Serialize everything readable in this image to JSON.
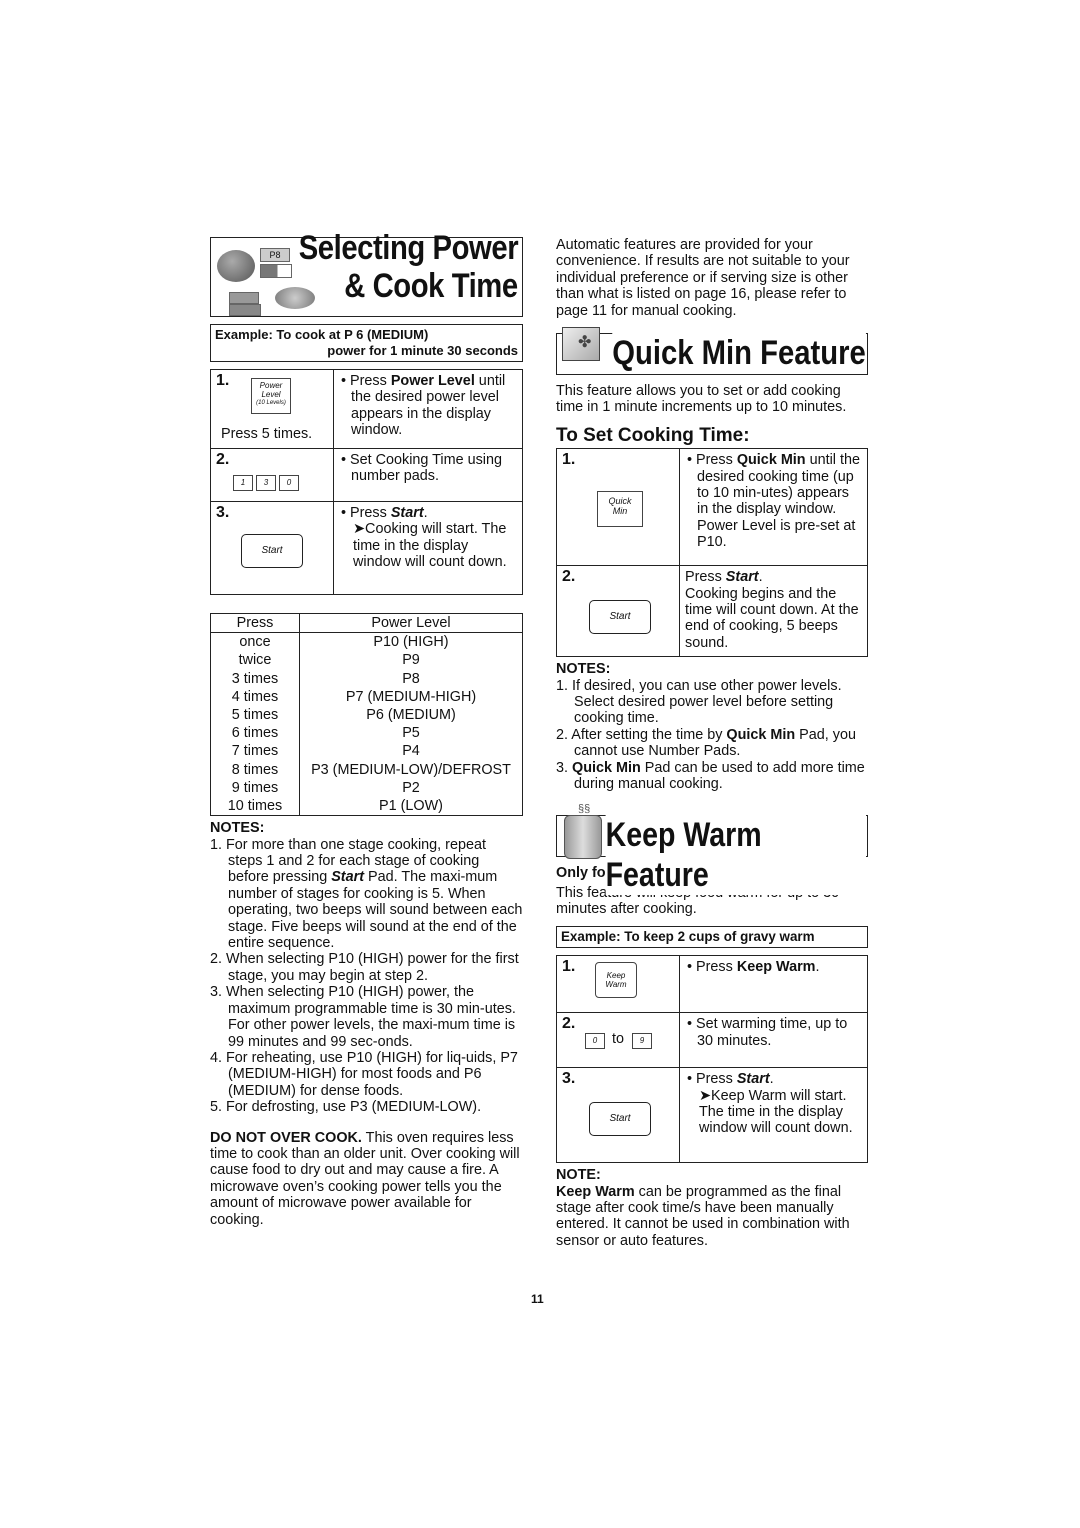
{
  "page_number": "11",
  "left": {
    "title_line1": "Selecting Power",
    "title_line2": "& Cook Time",
    "title_icons": {
      "display_text": "P8"
    },
    "example": {
      "line1": "Example: To cook at P 6 (MEDIUM)",
      "line2": "power for 1 minute 30 seconds"
    },
    "steps": [
      {
        "num": "1.",
        "pad_lines": [
          "Power",
          "Level",
          "(10 Levels)"
        ],
        "caption": "Press 5 times.",
        "text_pre": "• Press ",
        "text_bold": "Power Level",
        "text_post": " until the desired power level appears in the display window."
      },
      {
        "num": "2.",
        "number_pads": [
          "1",
          "3",
          "0"
        ],
        "text": "• Set Cooking Time using number pads."
      },
      {
        "num": "3.",
        "pad": "Start",
        "text_pre": "• Press ",
        "text_bi": "Start",
        "text_post": ".",
        "arrow_text": "➤Cooking will start. The time in the display window will count down."
      }
    ],
    "power_table": {
      "headers": [
        "Press",
        "Power Level"
      ],
      "rows": [
        [
          "once",
          "P10 (HIGH)"
        ],
        [
          "twice",
          "P9"
        ],
        [
          "3 times",
          "P8"
        ],
        [
          "4 times",
          "P7 (MEDIUM-HIGH)"
        ],
        [
          "5 times",
          "P6 (MEDIUM)"
        ],
        [
          "6 times",
          "P5"
        ],
        [
          "7 times",
          "P4"
        ],
        [
          "8 times",
          "P3 (MEDIUM-LOW)/DEFROST"
        ],
        [
          "9 times",
          "P2"
        ],
        [
          "10 times",
          "P1 (LOW)"
        ]
      ]
    },
    "notes_heading": "NOTES:",
    "notes": [
      {
        "num": "1. ",
        "pre": "For more than one stage cooking, repeat steps 1 and 2 for each stage of cooking before pressing ",
        "bi": "Start",
        "post": " Pad. The maxi-mum number of stages for cooking is 5. When operating, two beeps will sound between each stage. Five beeps will sound at the end of the entire sequence."
      },
      {
        "num": "2. ",
        "pre": "When selecting P10 (HIGH) power for the first stage, you may begin at step 2."
      },
      {
        "num": "3. ",
        "pre": "When selecting P10 (HIGH) power, the maximum programmable time is 30 min-utes. For other power levels, the maxi-mum time is 99 minutes and 99 sec-onds."
      },
      {
        "num": "4. ",
        "pre": "For reheating, use P10 (HIGH) for liq-uids, P7 (MEDIUM-HIGH) for most foods and P6 (MEDIUM) for dense foods."
      },
      {
        "num": "5. ",
        "pre": "For defrosting, use P3 (MEDIUM-LOW)."
      }
    ],
    "warning_bold": "DO NOT OVER COOK.",
    "warning_text": " This oven requires less time to cook than an older unit. Over cooking will cause food to dry out and may cause a fire. A microwave oven’s cooking power tells you the amount of microwave power available for cooking."
  },
  "right": {
    "intro": "Automatic features are provided for your convenience. If results are not suitable to your individual preference or if serving size is other than what is listed on page 16, please refer to page 11 for manual cooking.",
    "quick_min": {
      "title": "Quick Min Feature",
      "description": "This feature allows you to set or add cooking time in 1 minute increments up to 10 minutes.",
      "subheading": "To Set Cooking Time:",
      "steps": [
        {
          "num": "1.",
          "pad_lines": [
            "Quick",
            "Min"
          ],
          "text_pre": "• Press ",
          "text_bold": "Quick Min",
          "text_post": " until the desired cooking time (up to 10 min-utes) appears in the display window. Power Level is pre-set at P10."
        },
        {
          "num": "2.",
          "pad": "Start",
          "text_pre": "Press ",
          "text_bi": "Start",
          "text_post": ".",
          "text_rest": "Cooking begins and the time will count down. At the end of cooking, 5 beeps sound."
        }
      ],
      "notes_heading": "NOTES:",
      "notes": [
        {
          "num": "1. ",
          "pre": "If desired, you can use other power levels. Select desired power level before setting cooking time."
        },
        {
          "num": "2. ",
          "pre": "After setting the time by ",
          "bold": "Quick Min",
          "post": " Pad, you cannot use Number Pads."
        },
        {
          "num": "3. ",
          "bold_first": "Quick Min",
          "post": " Pad can be used to add more time during manual cooking."
        }
      ]
    },
    "keep_warm": {
      "title": "Keep Warm Feature",
      "model_note": "Only for NN-H634:",
      "description": "This feature will keep food warm for up to 30 minutes after cooking.",
      "example": "Example: To keep 2 cups of gravy warm",
      "steps": [
        {
          "num": "1.",
          "pad_lines": [
            "Keep",
            "Warm"
          ],
          "text_pre": "• Press ",
          "text_bold": "Keep Warm",
          "text_post": "."
        },
        {
          "num": "2.",
          "pad_from": "0",
          "to_label": "to",
          "pad_to": "9",
          "text": "• Set warming time, up to 30 minutes."
        },
        {
          "num": "3.",
          "pad": "Start",
          "text_pre": "• Press ",
          "text_bi": "Start",
          "text_post": ".",
          "arrow_text": "➤Keep Warm will start. The time in the display window will count down."
        }
      ],
      "note_heading": "NOTE:",
      "note_bold": "Keep Warm",
      "note_text": " can be programmed as the final stage after cook time/s have been manually entered. It cannot be used in combination with sensor or auto features."
    }
  }
}
